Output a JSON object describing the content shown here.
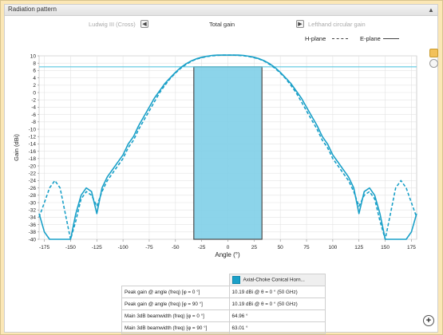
{
  "window": {
    "title": "Radiation pattern"
  },
  "selectors": {
    "left": "Ludwig III (Cross)",
    "center": "Total gain",
    "right": "Lefthand circular gain"
  },
  "legend": {
    "h_plane": "H-plane",
    "e_plane": "E-plane"
  },
  "colors": {
    "curve": "#1aa0c8",
    "band": "#7fcfe8",
    "reference": "#5cc8e0"
  },
  "chart_data": {
    "type": "line",
    "xlabel": "Angle (°)",
    "ylabel": "Gain (dBi)",
    "xlim": [
      -180,
      180
    ],
    "ylim": [
      -40,
      10
    ],
    "xticks": [
      -175,
      -150,
      -125,
      -100,
      -75,
      -50,
      -25,
      0,
      25,
      50,
      75,
      100,
      125,
      150,
      175
    ],
    "yticks": [
      10,
      8,
      6,
      4,
      2,
      0,
      -2,
      -4,
      -6,
      -8,
      -10,
      -12,
      -14,
      -16,
      -18,
      -20,
      -22,
      -24,
      -26,
      -28,
      -30,
      -32,
      -34,
      -36,
      -38,
      -40
    ],
    "reference_line": 7,
    "highlight_band": [
      -32.5,
      32.5
    ],
    "series": [
      {
        "name": "E-plane",
        "x": [
          -180,
          -175,
          -170,
          -165,
          -160,
          -155,
          -150,
          -145,
          -140,
          -135,
          -130,
          -125,
          -120,
          -115,
          -110,
          -105,
          -100,
          -95,
          -90,
          -85,
          -80,
          -75,
          -70,
          -65,
          -60,
          -55,
          -50,
          -45,
          -40,
          -35,
          -30,
          -25,
          -20,
          -15,
          -10,
          -5,
          0,
          5,
          10,
          15,
          20,
          25,
          30,
          35,
          40,
          45,
          50,
          55,
          60,
          65,
          70,
          75,
          80,
          85,
          90,
          95,
          100,
          105,
          110,
          115,
          120,
          125,
          130,
          135,
          140,
          145,
          150,
          155,
          160,
          165,
          170,
          175,
          180
        ],
        "y": [
          -33,
          -38,
          -40,
          -40,
          -40,
          -40,
          -40,
          -33,
          -28,
          -26,
          -27,
          -33,
          -26,
          -23,
          -21,
          -19,
          -17,
          -14,
          -12,
          -9,
          -6.5,
          -4,
          -1.5,
          0.5,
          2.5,
          4,
          5.5,
          6.8,
          7.8,
          8.6,
          9.2,
          9.6,
          9.9,
          10.1,
          10.2,
          10.2,
          10.19,
          10.2,
          10.2,
          10.1,
          9.9,
          9.6,
          9.2,
          8.6,
          7.8,
          6.8,
          5.5,
          4,
          2.5,
          0.5,
          -1.5,
          -4,
          -6.5,
          -9,
          -12,
          -14,
          -17,
          -19,
          -21,
          -23,
          -26,
          -33,
          -27,
          -26,
          -28,
          -33,
          -40,
          -40,
          -40,
          -40,
          -40,
          -38,
          -33
        ]
      },
      {
        "name": "H-plane",
        "x": [
          -180,
          -175,
          -170,
          -165,
          -160,
          -155,
          -150,
          -145,
          -140,
          -135,
          -130,
          -125,
          -120,
          -115,
          -110,
          -105,
          -100,
          -95,
          -90,
          -85,
          -80,
          -75,
          -70,
          -65,
          -60,
          -55,
          -50,
          -45,
          -40,
          -35,
          -30,
          -25,
          -20,
          -15,
          -10,
          -5,
          0,
          5,
          10,
          15,
          20,
          25,
          30,
          35,
          40,
          45,
          50,
          55,
          60,
          65,
          70,
          75,
          80,
          85,
          90,
          95,
          100,
          105,
          110,
          115,
          120,
          125,
          130,
          135,
          140,
          145,
          150,
          155,
          160,
          165,
          170,
          175,
          180
        ],
        "y": [
          -34,
          -30,
          -26,
          -24,
          -26,
          -33,
          -40,
          -35,
          -29,
          -27,
          -28,
          -31,
          -27,
          -24,
          -22,
          -20,
          -18,
          -15,
          -13,
          -10,
          -7.5,
          -5,
          -2.5,
          0,
          2,
          3.8,
          5.3,
          6.6,
          7.6,
          8.5,
          9.1,
          9.5,
          9.8,
          10,
          10.1,
          10.2,
          10.19,
          10.2,
          10.1,
          10,
          9.8,
          9.5,
          9.1,
          8.5,
          7.6,
          6.6,
          5.3,
          3.8,
          2,
          0,
          -2.5,
          -5,
          -7.5,
          -10,
          -13,
          -15,
          -18,
          -20,
          -22,
          -24,
          -27,
          -31,
          -28,
          -27,
          -29,
          -35,
          -40,
          -33,
          -26,
          -24,
          -26,
          -30,
          -34
        ]
      }
    ]
  },
  "table": {
    "header": "Axial-Choke Conical Horn...",
    "rows": [
      {
        "label": "Peak gain @ angle (freq) [φ = 0 °]",
        "value": "10.19 dBi @ θ = 0 ° (50 GHz)"
      },
      {
        "label": "Peak gain @ angle (freq) [φ = 90 °]",
        "value": "10.19 dBi @ θ = 0 ° (50 GHz)"
      },
      {
        "label": "Main 3dB beamwidth (freq) [φ = 0 °]",
        "value": "64.96 °"
      },
      {
        "label": "Main 3dB beamwidth (freq) [φ = 90 °]",
        "value": "63.01 °"
      }
    ]
  },
  "icons": [
    "collapse-icon",
    "arrow-left-icon",
    "arrow-right-icon",
    "settings-icon",
    "info-icon",
    "add-icon"
  ]
}
